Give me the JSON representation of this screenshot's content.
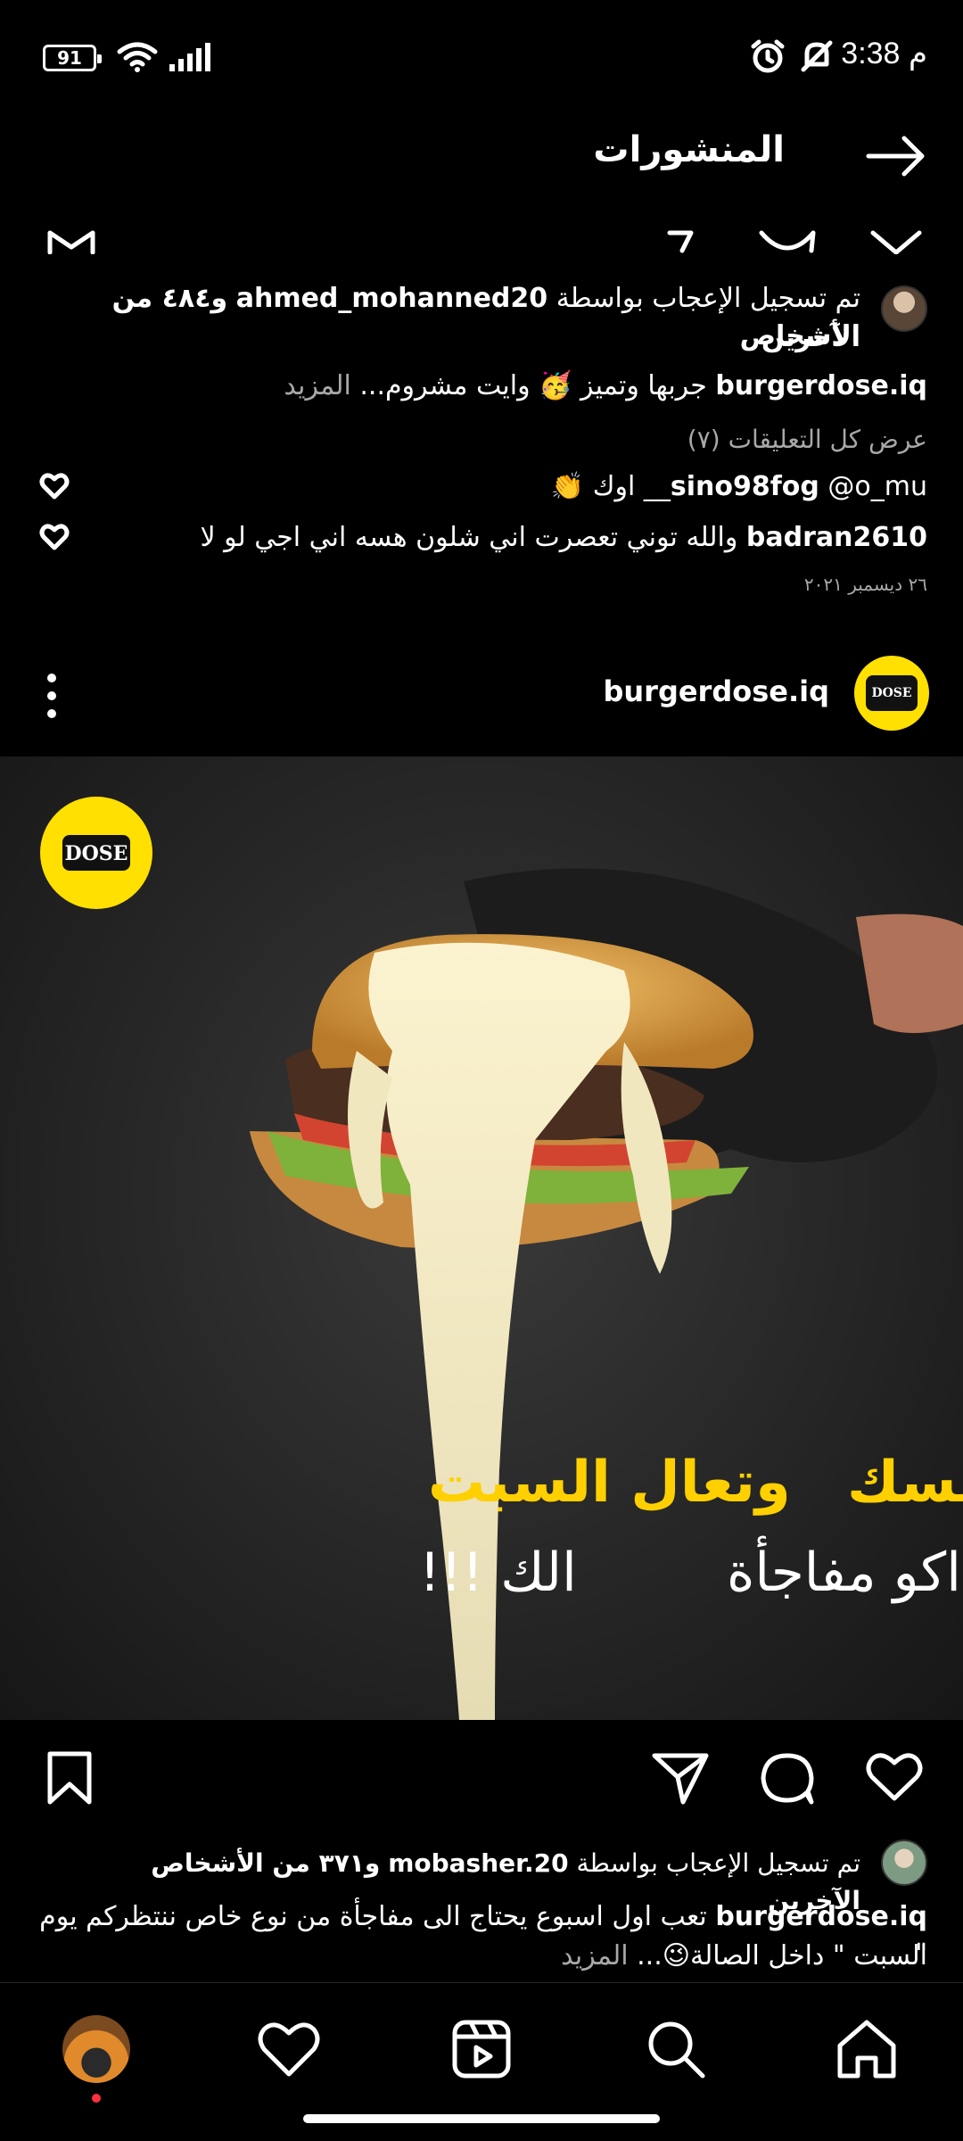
{
  "status_bar": {
    "time": "3:38",
    "am_pm": "م",
    "battery": "91",
    "icons": [
      "alarm-icon",
      "mute-icon",
      "wifi-icon",
      "signal-icon"
    ]
  },
  "header": {
    "title": "المنشورات",
    "back_icon": "arrow-right-icon"
  },
  "prev_post": {
    "likes_prefix": "تم تسجيل الإعجاب بواسطة",
    "likes_user": "ahmed_mohanned20",
    "likes_suffix": "و٤٨٤ من الأشخاص",
    "likes_suffix2": "الآخرين",
    "caption_user": "burgerdose.iq",
    "caption_text": "جربها وتميز 🥳 وايت مشروم...",
    "more": "المزيد",
    "view_comments": "عرض كل التعليقات (٧)",
    "comments": [
      {
        "user": "sino98fog",
        "text": "@o_mu__ اوك 👏"
      },
      {
        "user": "badran2610",
        "text": "والله توني تعصرت اني شلون هسه اني اجي لو لا"
      }
    ],
    "date": "٢٦ ديسمبر ٢٠٢١"
  },
  "post": {
    "username": "burgerdose.iq",
    "image_text_line1a": "تعب نفسك",
    "image_text_line1b": "وتعال السبت",
    "image_text_line2a": "اكو مفاجأة",
    "image_text_line2b": "الك !!!",
    "logo_text": "DOSE",
    "likes_prefix": "تم تسجيل الإعجاب بواسطة",
    "likes_user": "mobasher.20",
    "likes_suffix": "و٣٧١ من الأشخاص الآخرين",
    "caption_user": "burgerdose.iq",
    "caption_text1": "تعب اول اسبوع يحتاج الى مفاجأة من نوع خاص ننتظركم يوم \"",
    "caption_text2": "السبت \" داخل الصالة😉...",
    "more": "المزيد"
  },
  "nav": [
    "home-icon",
    "search-icon",
    "reels-icon",
    "heart-icon",
    "profile-avatar"
  ],
  "colors": {
    "background": "#000000",
    "muted": "#a8a8a8",
    "accent_yellow": "#ffe000",
    "notification_dot": "#ff3040"
  }
}
